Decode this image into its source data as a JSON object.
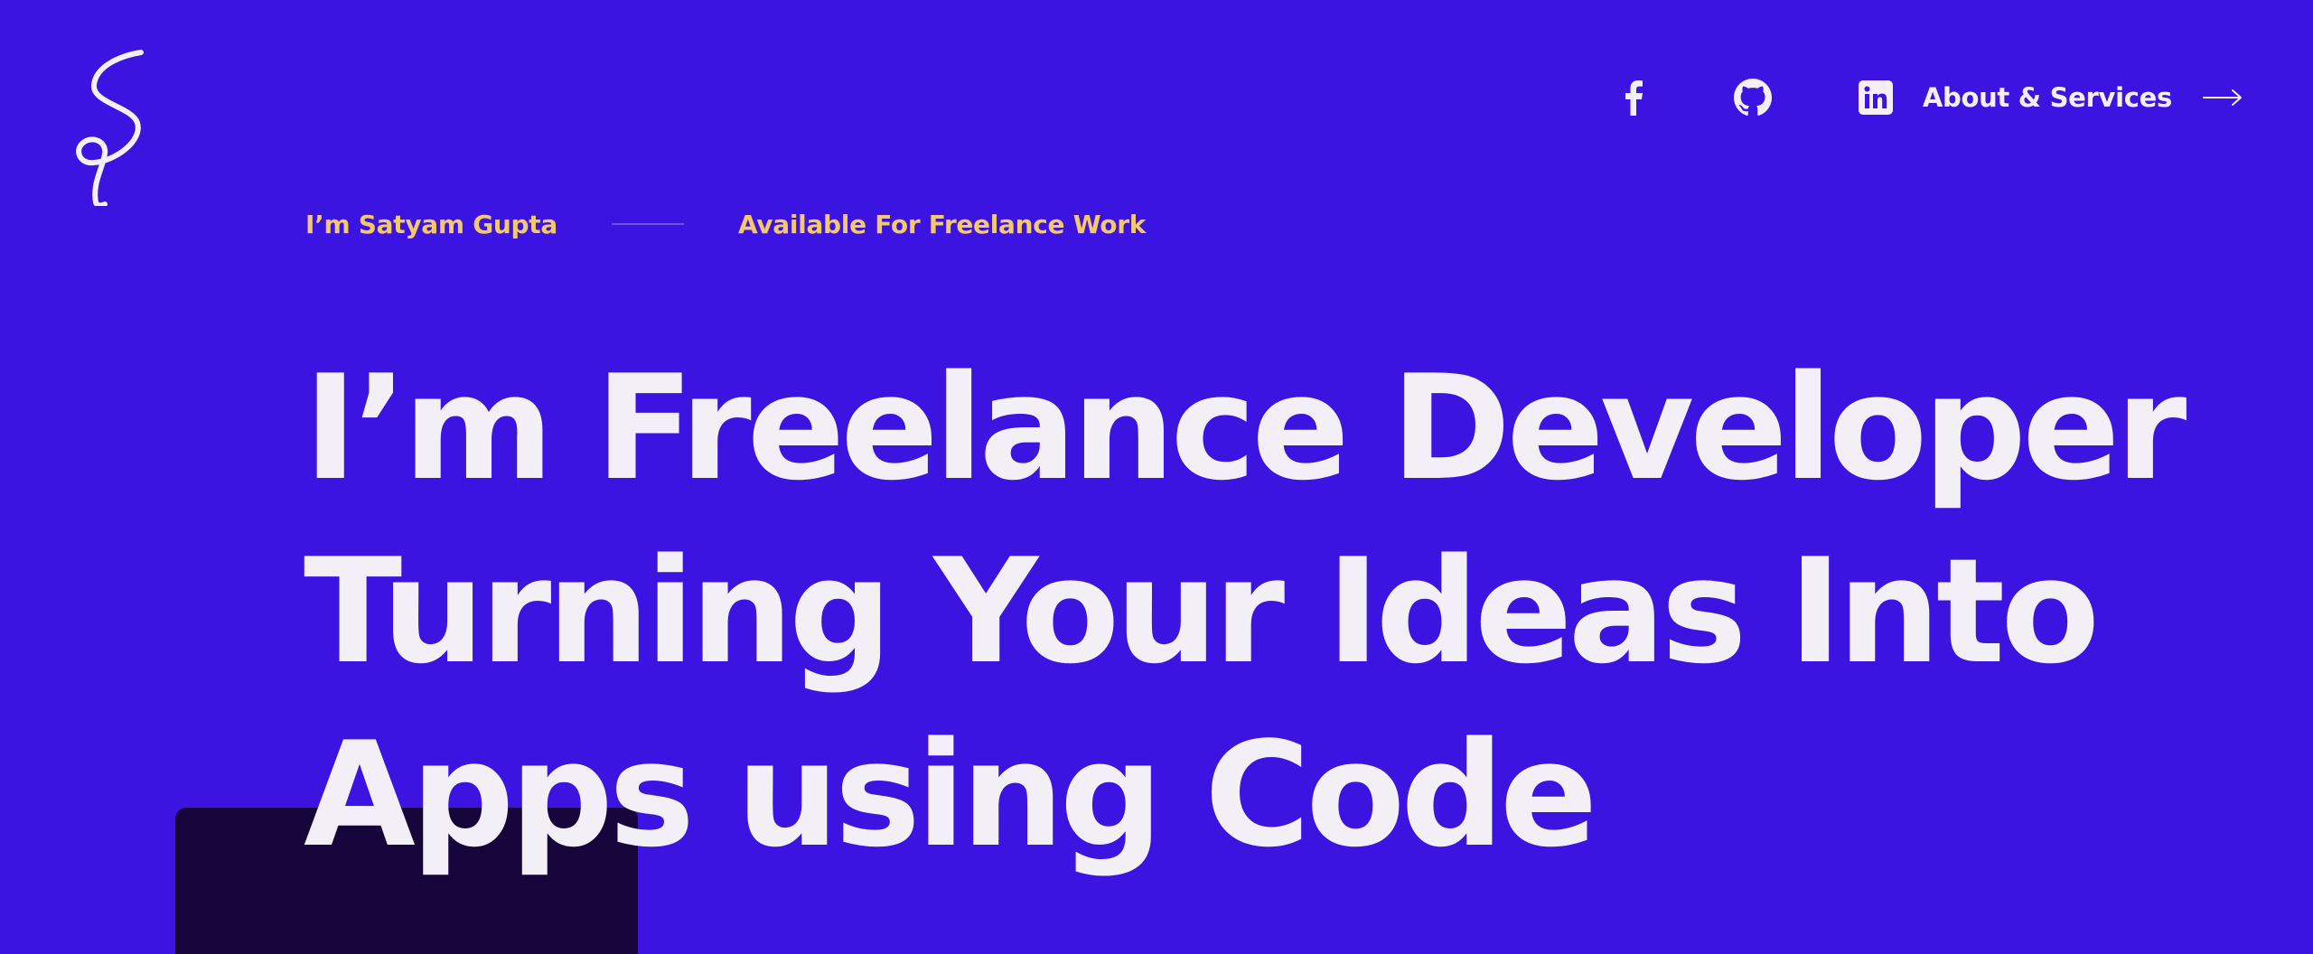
{
  "brand": {
    "logo_icon": "signature-logo-icon"
  },
  "nav": {
    "social": [
      {
        "name": "facebook-icon"
      },
      {
        "name": "github-icon"
      },
      {
        "name": "linkedin-icon"
      }
    ],
    "about_label": "About & Services",
    "arrow_icon": "arrow-right-icon"
  },
  "intro": {
    "name": "I’m Satyam Gupta",
    "availability": "Available For Freelance Work"
  },
  "hero": {
    "line1": "I’m Freelance Developer",
    "line2": "Turning Your Ideas Into",
    "line3": "Apps using Code"
  },
  "colors": {
    "background": "#3c14e1",
    "accent": "#f4c96a",
    "text": "#f2f0f6",
    "card": "#16053a"
  }
}
